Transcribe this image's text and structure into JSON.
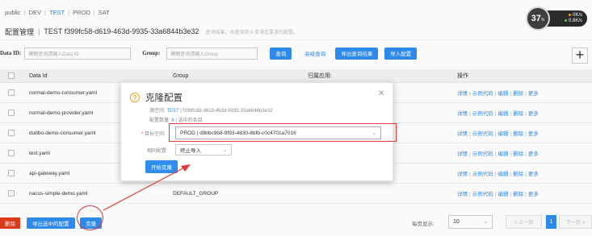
{
  "namespaces": [
    "public",
    "DEV",
    "TEST",
    "PROD",
    "SAT"
  ],
  "active_namespace": "TEST",
  "gauge": {
    "percent": "37",
    "percent_unit": "%",
    "up_rate": "0K/s",
    "down_rate": "0.8K/s"
  },
  "header": {
    "title": "配置管理",
    "namespace_id": "TEST  f399fc58-d619-463d-9935-33a6844b3e32",
    "hint": "查询结果，共查询到 6 条满足要求的配置。"
  },
  "filters": {
    "data_id_label": "Data ID:",
    "data_id_placeholder": "模糊查询请输入Data ID",
    "group_label": "Group:",
    "group_placeholder": "模糊查询请输入Group",
    "query_btn": "查询",
    "advanced_link": "高级查询",
    "export_btn": "导出查询结果",
    "import_btn": "导入配置",
    "add_btn": "+"
  },
  "table": {
    "columns": [
      "Data Id",
      "Group",
      "归属应用:",
      "操作"
    ],
    "rows": [
      {
        "data_id": "normal-demo-consumer.yaml",
        "group": "",
        "app": ""
      },
      {
        "data_id": "normal-demo-provider.yaml",
        "group": "",
        "app": ""
      },
      {
        "data_id": "dubbo-demo-consumer.yaml",
        "group": "",
        "app": ""
      },
      {
        "data_id": "test.yaml",
        "group": "",
        "app": ""
      },
      {
        "data_id": "api-gateway.yaml",
        "group": "",
        "app": ""
      },
      {
        "data_id": "nacos-simple-demo.yaml",
        "group": "DEFAULT_GROUP",
        "app": ""
      }
    ],
    "ops": [
      "详情",
      "示例代码",
      "编辑",
      "删除",
      "更多"
    ]
  },
  "bottom": {
    "delete_btn": "删除",
    "export_selected_btn": "导出选中的配置",
    "clone_btn": "克隆",
    "per_page_label": "每页显示:",
    "per_page_value": "10",
    "prev": "< 上一页",
    "page": "1",
    "next": "下一页 >"
  },
  "dialog": {
    "title": "克隆配置",
    "source_label": "源空间:",
    "source_ns": "TEST",
    "source_id": "| f399fc58-d619-463d-9935-33a6844b3e32",
    "count_label": "配置数量:",
    "count_value": "6",
    "count_suffix": "| 选中的条目",
    "target_label": "目标空间:",
    "target_value": "PROD | d9bbc9b8-9f93-4830-8bfb-c0c4701a7016",
    "conflict_label": "相同配置:",
    "conflict_value": "终止导入",
    "start_btn": "开始克隆",
    "required_mark": "*"
  },
  "colors": {
    "accent": "#2e8ded",
    "danger": "#e03c1e",
    "annotation": "#e03c3c"
  }
}
